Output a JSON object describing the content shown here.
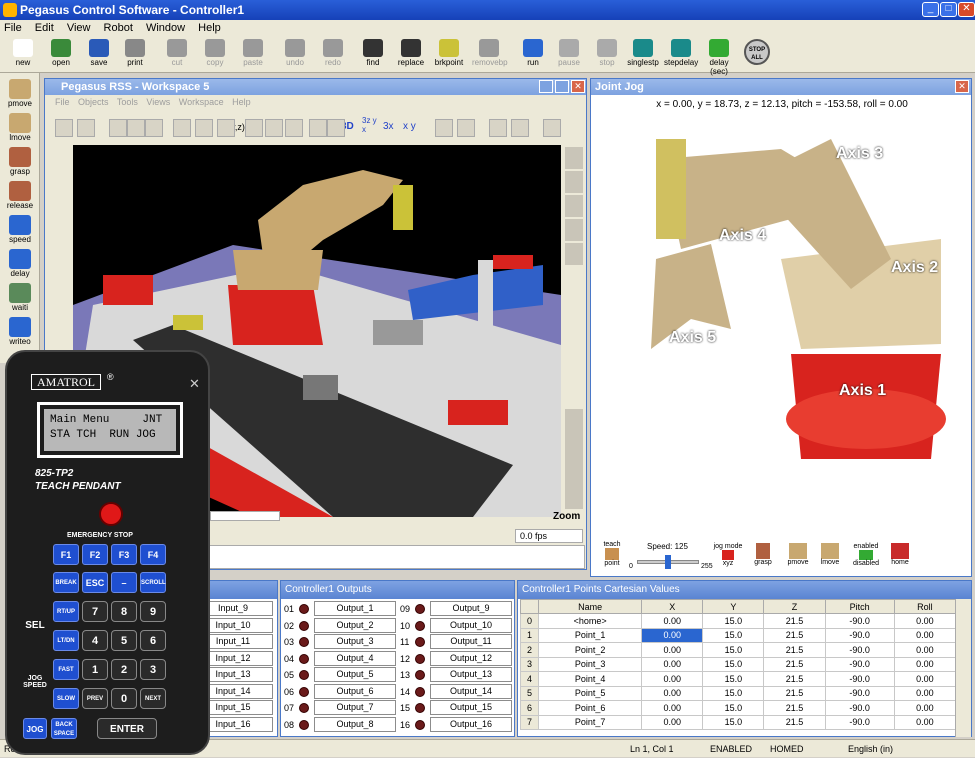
{
  "app": {
    "title": "Pegasus Control Software - Controller1"
  },
  "menu": [
    "File",
    "Edit",
    "View",
    "Robot",
    "Window",
    "Help"
  ],
  "toolbar": [
    {
      "label": "new",
      "icon": "new-file-icon",
      "disabled": false
    },
    {
      "label": "open",
      "icon": "open-folder-icon",
      "disabled": false
    },
    {
      "label": "save",
      "icon": "save-disk-icon",
      "disabled": false
    },
    {
      "label": "print",
      "icon": "printer-icon",
      "disabled": false
    },
    {
      "label": "cut",
      "icon": "scissors-icon",
      "disabled": true
    },
    {
      "label": "copy",
      "icon": "copy-icon",
      "disabled": true
    },
    {
      "label": "paste",
      "icon": "paste-icon",
      "disabled": true
    },
    {
      "label": "undo",
      "icon": "undo-icon",
      "disabled": true
    },
    {
      "label": "redo",
      "icon": "redo-icon",
      "disabled": true
    },
    {
      "label": "find",
      "icon": "binoculars-icon",
      "disabled": false
    },
    {
      "label": "replace",
      "icon": "binoculars-replace-icon",
      "disabled": false
    },
    {
      "label": "brkpoint",
      "icon": "flag-icon",
      "disabled": false
    },
    {
      "label": "removebp",
      "icon": "flag-remove-icon",
      "disabled": true
    },
    {
      "label": "run",
      "icon": "play-icon",
      "disabled": false
    },
    {
      "label": "pause",
      "icon": "pause-icon",
      "disabled": true
    },
    {
      "label": "stop",
      "icon": "stop-icon",
      "disabled": true
    },
    {
      "label": "singlestp",
      "icon": "single-step-icon",
      "disabled": false
    },
    {
      "label": "stepdelay",
      "icon": "step-delay-icon",
      "disabled": false
    },
    {
      "label": "delay (sec)",
      "icon": "delay-slider-icon",
      "disabled": false
    },
    {
      "label": "STOP ALL",
      "icon": "stop-all-icon",
      "disabled": false
    }
  ],
  "side_tools": [
    {
      "label": "pmove",
      "icon": "pmove-icon"
    },
    {
      "label": "lmove",
      "icon": "lmove-icon"
    },
    {
      "label": "grasp",
      "icon": "grasp-icon"
    },
    {
      "label": "release",
      "icon": "release-icon"
    },
    {
      "label": "speed",
      "icon": "speed-icon"
    },
    {
      "label": "delay",
      "icon": "clock-icon"
    },
    {
      "label": "waiti",
      "icon": "waiti-icon"
    },
    {
      "label": "writeo",
      "icon": "writeo-icon"
    }
  ],
  "workspace": {
    "title": "Pegasus RSS - Workspace 5",
    "menu": [
      "File",
      "Objects",
      "Tools",
      "Views",
      "Workspace",
      "Help"
    ],
    "toolbar_labels": [
      "(x,y,z)",
      "3D",
      "3z y x",
      "3x",
      "x y"
    ],
    "zoom_label": "Zoom",
    "fps": "0.0 fps"
  },
  "joint_jog": {
    "title": "Joint Jog",
    "coords": "x = 0.00, y = 18.73, z = 12.13, pitch = -153.58, roll = 0.00",
    "axes": [
      "Axis 1",
      "Axis 2",
      "Axis 3",
      "Axis 4",
      "Axis 5"
    ],
    "teach_label": "teach",
    "point_label": "point",
    "speed_label": "Speed: 125",
    "speed_min": "0",
    "speed_max": "255",
    "speed_value": 125,
    "jog_mode_label": "jog mode",
    "jog_mode_value": "xyz",
    "buttons": [
      "grasp",
      "pmove",
      "lmove"
    ],
    "enabled_label": "enabled",
    "disabled_label": "disabled",
    "home_label": "home"
  },
  "inputs": {
    "items": [
      "Input_9",
      "Input_10",
      "Input_11",
      "Input_12",
      "Input_13",
      "Input_14",
      "Input_15",
      "Input_16"
    ]
  },
  "outputs": {
    "title": "Controller1 Outputs",
    "left_nums": [
      "01",
      "02",
      "03",
      "04",
      "05",
      "06",
      "07",
      "08"
    ],
    "left": [
      "Output_1",
      "Output_2",
      "Output_3",
      "Output_4",
      "Output_5",
      "Output_6",
      "Output_7",
      "Output_8"
    ],
    "right_nums": [
      "09",
      "10",
      "11",
      "12",
      "13",
      "14",
      "15",
      "16"
    ],
    "right": [
      "Output_9",
      "Output_10",
      "Output_11",
      "Output_12",
      "Output_13",
      "Output_14",
      "Output_15",
      "Output_16"
    ]
  },
  "points": {
    "title": "Controller1 Points Cartesian Values",
    "columns": [
      "Name",
      "X",
      "Y",
      "Z",
      "Pitch",
      "Roll"
    ],
    "rows": [
      [
        "0",
        "<home>",
        "0.00",
        "15.0",
        "21.5",
        "-90.0",
        "0.00"
      ],
      [
        "1",
        "Point_1",
        "0.00",
        "15.0",
        "21.5",
        "-90.0",
        "0.00"
      ],
      [
        "2",
        "Point_2",
        "0.00",
        "15.0",
        "21.5",
        "-90.0",
        "0.00"
      ],
      [
        "3",
        "Point_3",
        "0.00",
        "15.0",
        "21.5",
        "-90.0",
        "0.00"
      ],
      [
        "4",
        "Point_4",
        "0.00",
        "15.0",
        "21.5",
        "-90.0",
        "0.00"
      ],
      [
        "5",
        "Point_5",
        "0.00",
        "15.0",
        "21.5",
        "-90.0",
        "0.00"
      ],
      [
        "6",
        "Point_6",
        "0.00",
        "15.0",
        "21.5",
        "-90.0",
        "0.00"
      ],
      [
        "7",
        "Point_7",
        "0.00",
        "15.0",
        "21.5",
        "-90.0",
        "0.00"
      ]
    ]
  },
  "status": {
    "ready": "Ready",
    "position": "Ln 1, Col 1",
    "enabled": "ENABLED",
    "homed": "HOMED",
    "units": "English (in)"
  },
  "pendant": {
    "brand": "AMATROL",
    "registered": "®",
    "screen_line1": "Main Menu     JNT",
    "screen_line2": "STA TCH  RUN JOG",
    "model": "825-TP2",
    "model_sub": "TEACH PENDANT",
    "estop_label": "EMERGENCY STOP",
    "fkeys": [
      "F1",
      "F2",
      "F3",
      "F4"
    ],
    "row2": [
      "BREAK",
      "ESC",
      "–",
      "SCROLL"
    ],
    "keypad": [
      [
        "RT/UP",
        "7",
        "8",
        "9"
      ],
      [
        "LT/DN",
        "4",
        "5",
        "6"
      ],
      [
        "FAST",
        "1",
        "2",
        "3"
      ],
      [
        "SLOW",
        "PREV",
        "0",
        "NEXT"
      ]
    ],
    "sel_label": "SEL",
    "jog_speed_label": "JOG SPEED",
    "jog_label": "JOG",
    "backspace_label": "BACK SPACE",
    "enter_label": "ENTER"
  }
}
